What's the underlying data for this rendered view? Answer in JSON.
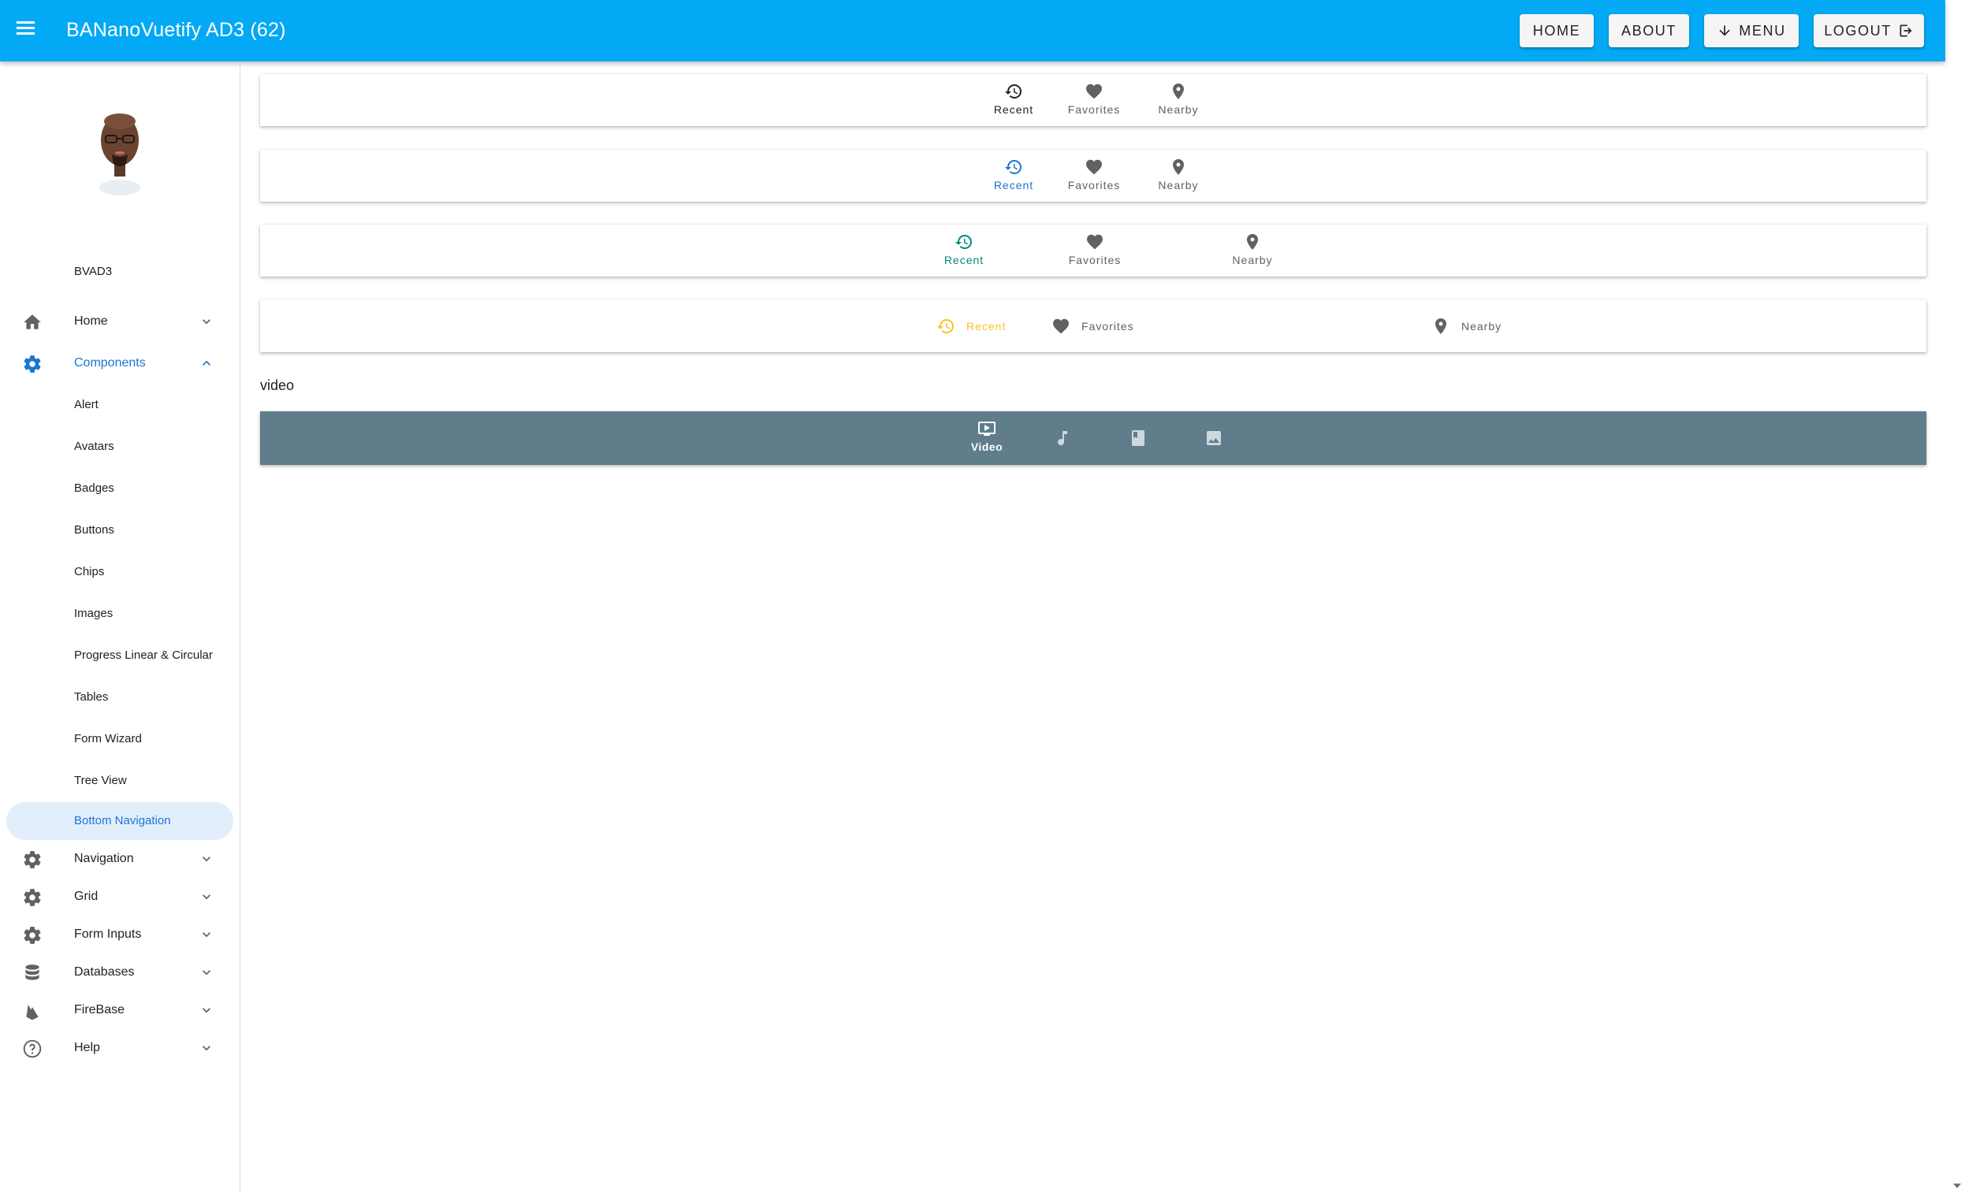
{
  "appbar": {
    "title": "BANanoVuetify AD3 (62)",
    "buttons": [
      {
        "label": "HOME"
      },
      {
        "label": "ABOUT"
      },
      {
        "label": "MENU",
        "icon": "arrow-down-icon"
      },
      {
        "label": "LOGOUT",
        "icon": "logout-icon"
      }
    ]
  },
  "sidebar": {
    "user_name": "BVAD3",
    "groups": [
      {
        "label": "Home",
        "icon": "home-icon"
      },
      {
        "label": "Components",
        "icon": "gear-icon"
      },
      {
        "label": "Navigation",
        "icon": "gear-icon"
      },
      {
        "label": "Grid",
        "icon": "gear-icon"
      },
      {
        "label": "Form Inputs",
        "icon": "gear-icon"
      },
      {
        "label": "Databases",
        "icon": "database-icon"
      },
      {
        "label": "FireBase",
        "icon": "firebase-icon"
      },
      {
        "label": "Help",
        "icon": "help-circle-icon"
      }
    ],
    "components_items": [
      {
        "label": "Alert"
      },
      {
        "label": "Avatars"
      },
      {
        "label": "Badges"
      },
      {
        "label": "Buttons"
      },
      {
        "label": "Chips"
      },
      {
        "label": "Images"
      },
      {
        "label": "Progress Linear & Circular"
      },
      {
        "label": "Tables"
      },
      {
        "label": "Form Wizard"
      },
      {
        "label": "Tree View"
      },
      {
        "label": "Bottom Navigation"
      }
    ]
  },
  "main": {
    "nav_bars": [
      {
        "items": [
          {
            "label": "Recent"
          },
          {
            "label": "Favorites"
          },
          {
            "label": "Nearby"
          }
        ],
        "active_color": "#212121"
      },
      {
        "items": [
          {
            "label": "Recent"
          },
          {
            "label": "Favorites"
          },
          {
            "label": "Nearby"
          }
        ],
        "active_color": "#1976d2"
      },
      {
        "items": [
          {
            "label": "Recent"
          },
          {
            "label": "Favorites"
          },
          {
            "label": "Nearby"
          }
        ],
        "active_color": "#00897b"
      },
      {
        "items": [
          {
            "label": "Recent"
          },
          {
            "label": "Favorites"
          },
          {
            "label": "Nearby"
          }
        ],
        "active_color": "#fbc02d"
      }
    ],
    "selected_value": "video",
    "media_nav": {
      "active_label": "Video",
      "icons": [
        "video-icon",
        "music-icon",
        "book-icon",
        "image-icon"
      ],
      "background": "#607d8b"
    }
  },
  "colors": {
    "appbar": "#03a9f4",
    "accent": "#1976d2"
  }
}
